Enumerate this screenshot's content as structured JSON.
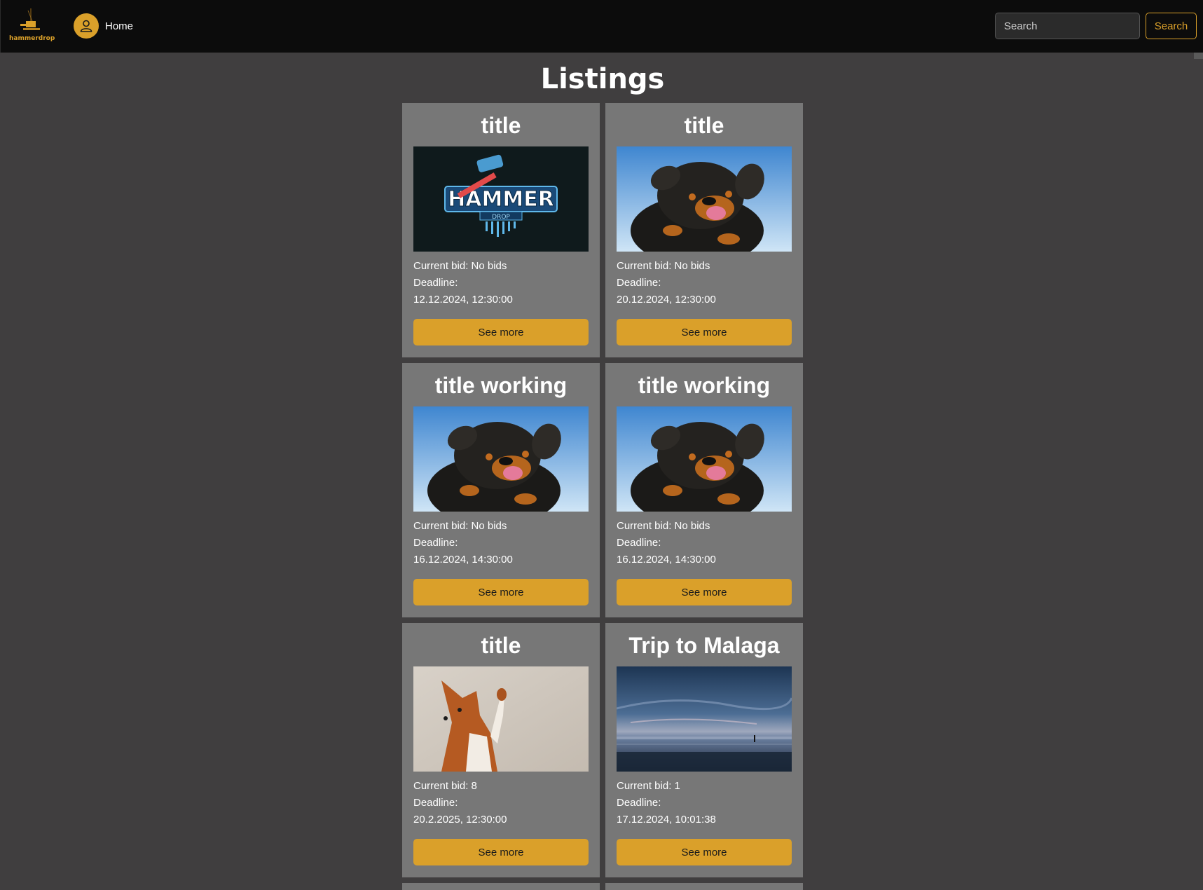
{
  "header": {
    "logo_text": "hammerdrop",
    "home_label": "Home",
    "search_placeholder": "Search",
    "search_button_label": "Search"
  },
  "page": {
    "title": "Listings"
  },
  "colors": {
    "accent": "#daa02a",
    "card_bg": "#777777",
    "page_bg": "#403e3f",
    "header_bg": "#0c0c0c"
  },
  "listings": [
    {
      "title": "title",
      "image": "hammer-drop-logo",
      "bid": "Current bid: No bids",
      "deadline_label": "Deadline:",
      "deadline": "12.12.2024, 12:30:00",
      "button": "See more"
    },
    {
      "title": "title",
      "image": "rottweiler-puppy-photo",
      "bid": "Current bid: No bids",
      "deadline_label": "Deadline:",
      "deadline": "20.12.2024, 12:30:00",
      "button": "See more"
    },
    {
      "title": "title working",
      "image": "rottweiler-puppy-photo",
      "bid": "Current bid: No bids",
      "deadline_label": "Deadline:",
      "deadline": "16.12.2024, 14:30:00",
      "button": "See more"
    },
    {
      "title": "title working",
      "image": "rottweiler-puppy-photo",
      "bid": "Current bid: No bids",
      "deadline_label": "Deadline:",
      "deadline": "16.12.2024, 14:30:00",
      "button": "See more"
    },
    {
      "title": "title",
      "image": "basenji-dog-photo",
      "bid": "Current bid: 8",
      "deadline_label": "Deadline:",
      "deadline": "20.2.2025, 12:30:00",
      "button": "See more"
    },
    {
      "title": "Trip to Malaga",
      "image": "beach-sunset-photo",
      "bid": "Current bid: 1",
      "deadline_label": "Deadline:",
      "deadline": "17.12.2024, 10:01:38",
      "button": "See more"
    }
  ]
}
